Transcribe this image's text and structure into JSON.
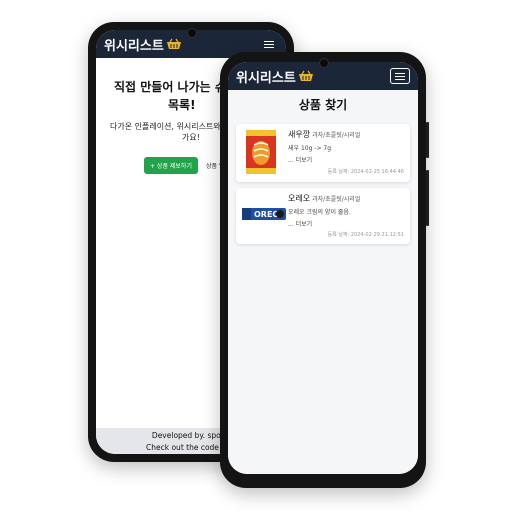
{
  "back_phone": {
    "brand": "위시리스트",
    "hero_line1": "직접 만들어 나가는 슈링",
    "hero_line2": "목록!",
    "sub_line1": "다가온 인플레이션, 위시리스트와",
    "sub_line2": "가요!",
    "primary_button": "+ 상품 제보하기",
    "secondary_button": "상품 알",
    "footer_line1": "Developed by. spood",
    "footer_line2": "Check out the code at g"
  },
  "front_phone": {
    "brand": "위시리스트",
    "page_title": "상품 찾기",
    "products": [
      {
        "name": "새우깡",
        "category": "과자/초콜릿/시리얼",
        "description": "새우 10g -> 7g",
        "more": "... 더보기",
        "date": "등록 날짜: 2024-02-25 16:44:46",
        "icon": "shrimp-cracker-bag"
      },
      {
        "name": "오레오",
        "category": "과자/초콜릿/시리얼",
        "description": "오레오 크림의 양이 줄음.",
        "more": "... 더보기",
        "date": "등록 날짜: 2024-02-29 21:12:51",
        "icon": "oreo-package"
      }
    ]
  },
  "colors": {
    "header_bg": "#1b2638",
    "basket": "#e8b72f",
    "green_button": "#22a34a",
    "page_bg": "#f5f6f8"
  }
}
